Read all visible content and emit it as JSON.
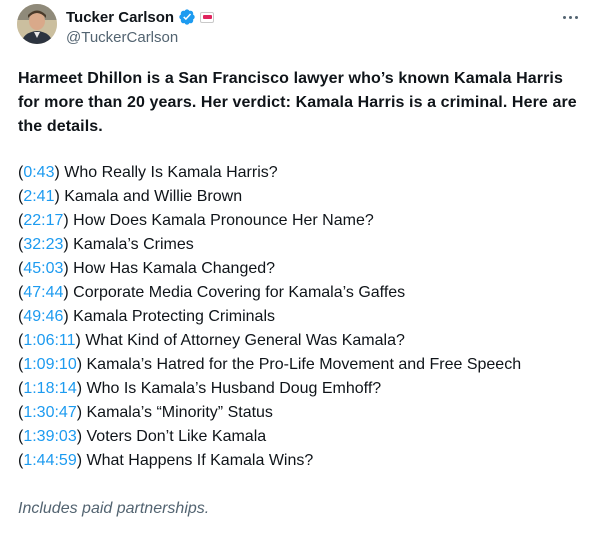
{
  "author": {
    "display_name": "Tucker Carlson",
    "handle": "@TuckerCarlson",
    "verified_icon": "verified-badge-icon",
    "affiliate_icon": "affiliate-badge-icon"
  },
  "menu": {
    "icon": "more-options-icon"
  },
  "post": {
    "intro": "Harmeet Dhillon is a San Francisco lawyer who’s known Kamala Harris for more than 20 years. Her verdict: Kamala Harris is a criminal. Here are the details.",
    "chapters": [
      {
        "time": "0:43",
        "title": "Who Really Is Kamala Harris?"
      },
      {
        "time": "2:41",
        "title": "Kamala and Willie Brown"
      },
      {
        "time": "22:17",
        "title": "How Does Kamala Pronounce Her Name?"
      },
      {
        "time": "32:23",
        "title": "Kamala’s Crimes"
      },
      {
        "time": "45:03",
        "title": "How Has Kamala Changed?"
      },
      {
        "time": "47:44",
        "title": "Corporate Media Covering for Kamala’s Gaffes"
      },
      {
        "time": "49:46",
        "title": "Kamala Protecting Criminals"
      },
      {
        "time": "1:06:11",
        "title": "What Kind of Attorney General Was Kamala?"
      },
      {
        "time": "1:09:10",
        "title": "Kamala’s Hatred for the Pro-Life Movement and Free Speech"
      },
      {
        "time": "1:18:14",
        "title": "Who Is Kamala’s Husband Doug Emhoff?"
      },
      {
        "time": "1:30:47",
        "title": "Kamala’s “Minority” Status"
      },
      {
        "time": "1:39:03",
        "title": "Voters Don’t Like Kamala"
      },
      {
        "time": "1:44:59",
        "title": "What Happens If Kamala Wins?"
      }
    ],
    "footer": "Includes paid partnerships."
  },
  "colors": {
    "link": "#1d9bf0",
    "text": "#0f1419",
    "secondary": "#536471",
    "verified": "#1d9bf0"
  }
}
